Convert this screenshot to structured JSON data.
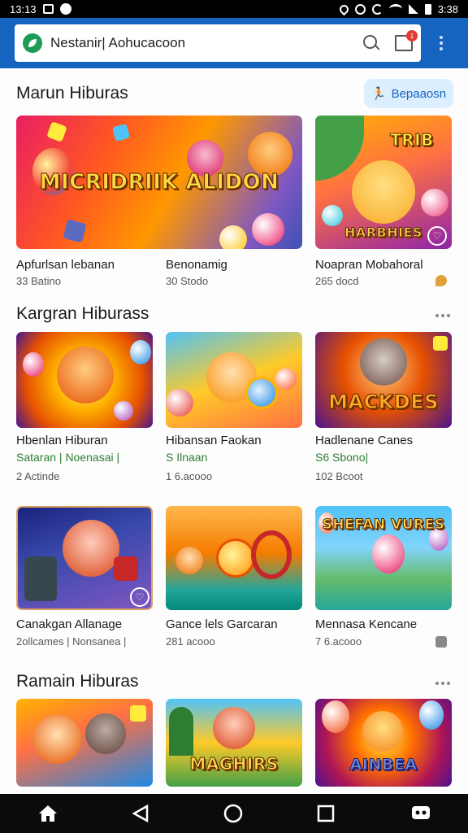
{
  "status_bar": {
    "time": "13:13",
    "clock_right": "3:38",
    "icons_left": [
      "sim-box-icon",
      "dot-icon"
    ],
    "icons_right": [
      "location-icon",
      "alarm-icon",
      "sync-icon",
      "wifi-icon",
      "signal-icon",
      "battery-icon"
    ]
  },
  "header": {
    "search_text": "Nestanir| Aohucacoon",
    "brand_icon": "leaf-icon",
    "notif_count": "1",
    "accent": "#1565c0"
  },
  "sections": [
    {
      "title": "Marun Hiburas",
      "action_label": "Bepaaosn",
      "cards": [
        {
          "title": "Apfurlsan lebanan",
          "sub": "33 Batino",
          "art": "MICRIDRIIK ALIDON"
        },
        {
          "title": "Benonamig",
          "sub": "30 Stodo"
        },
        {
          "title": "Noapran Mobahoral",
          "sub": "265 docd",
          "art": "HARBHIES"
        }
      ]
    },
    {
      "title": "Kargran Hiburass",
      "cards": [
        {
          "title": "Hbenlan Hiburan",
          "tag": "Sataran | Noenasai |",
          "sub": "2 Actinde"
        },
        {
          "title": "Hibansan Faokan",
          "tag": "S Ilnaan",
          "sub": "1 6.acooo"
        },
        {
          "title": "Hadlenane Canes",
          "tag": "S6 Sbono|",
          "sub": "102 Bcoot",
          "art": "MACKDES"
        }
      ]
    },
    {
      "cards": [
        {
          "title": "Canakgan Allanage",
          "sub": "2ollcames | Nonsanea |"
        },
        {
          "title": "Gance lels Garcaran",
          "sub": "281 acooo"
        },
        {
          "title": "Mennasa Kencane",
          "sub": "7 6.acooo",
          "art": "SHEFAN VURES"
        }
      ]
    },
    {
      "title": "Ramain Hiburas",
      "cards": [
        {
          "art": ""
        },
        {
          "art": "MAGHIRS"
        },
        {
          "art": "AINBEA"
        }
      ]
    }
  ],
  "nav": [
    "home-icon",
    "back-icon",
    "home-circle-icon",
    "recents-icon",
    "gamepad-icon"
  ]
}
